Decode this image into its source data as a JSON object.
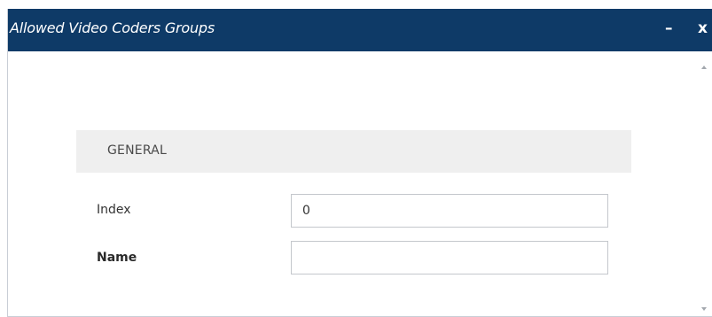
{
  "window": {
    "title": "Allowed Video Coders Groups",
    "minimize_label": "–",
    "close_label": "x"
  },
  "sections": {
    "general": {
      "title": "GENERAL"
    }
  },
  "fields": {
    "index": {
      "label": "Index",
      "value": "0"
    },
    "name": {
      "label": "Name",
      "value": ""
    }
  },
  "icons": {
    "scroll_up": "scroll-up-arrow-icon",
    "scroll_down": "scroll-down-arrow-icon"
  },
  "colors": {
    "titlebar": "#0e3a67",
    "section_header_bg": "#efefef",
    "input_border": "#c4c7cc"
  }
}
